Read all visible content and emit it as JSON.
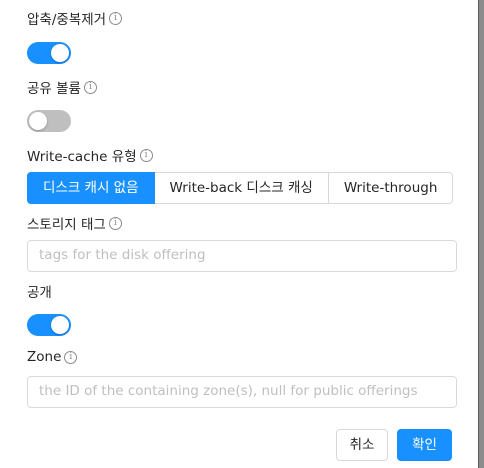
{
  "form": {
    "dedup": {
      "label": "압축/중복제거",
      "enabled": true
    },
    "shared_volume": {
      "label": "공유 볼륨",
      "enabled": false
    },
    "write_cache": {
      "label": "Write-cache 유형",
      "options": [
        "디스크 캐시 없음",
        "Write-back 디스크 캐싱",
        "Write-through"
      ],
      "selected": "디스크 캐시 없음"
    },
    "storage_tags": {
      "label": "스토리지 태그",
      "value": "",
      "placeholder": "tags for the disk offering"
    },
    "public": {
      "label": "공개",
      "enabled": true
    },
    "zone": {
      "label": "Zone",
      "value": "",
      "placeholder": "the ID of the containing zone(s), null for public offerings"
    }
  },
  "footer": {
    "cancel_label": "취소",
    "ok_label": "확인"
  },
  "icons": {
    "info": "info-circle-icon"
  },
  "colors": {
    "primary": "#1890ff",
    "toggle_off": "#bfbfbf",
    "border": "#d9d9d9"
  }
}
